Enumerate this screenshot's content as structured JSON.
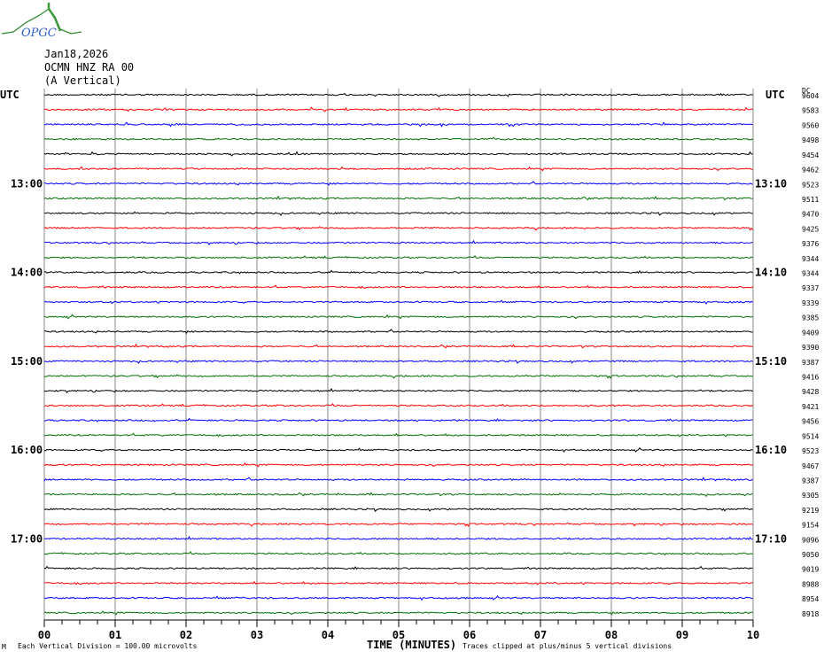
{
  "logo": {
    "text": "OPGC",
    "colors": {
      "curve": "#2e8b2e",
      "text": "#3060d0"
    }
  },
  "header": {
    "date": "Jan18,2026",
    "station": "OCMN HNZ RA 00",
    "component": "(A Vertical)"
  },
  "chart_data": {
    "type": "line",
    "title": "OCMN HNZ RA 00 (A Vertical) Jan18,2026",
    "xlabel": "TIME (MINUTES)",
    "xlim": [
      0,
      10
    ],
    "x_ticks": [
      "00",
      "01",
      "02",
      "03",
      "04",
      "05",
      "06",
      "07",
      "08",
      "09",
      "10"
    ],
    "left_axis_label": "UTC",
    "right_axis_label": "UTC",
    "dc_label": "DC",
    "rows_per_hour": 6,
    "left_time_labels": [
      {
        "row": 6,
        "text": "13:00"
      },
      {
        "row": 12,
        "text": "14:00"
      },
      {
        "row": 18,
        "text": "15:00"
      },
      {
        "row": 24,
        "text": "16:00"
      },
      {
        "row": 30,
        "text": "17:00"
      }
    ],
    "right_time_labels": [
      {
        "row": 6,
        "text": "13:10"
      },
      {
        "row": 12,
        "text": "14:10"
      },
      {
        "row": 18,
        "text": "15:10"
      },
      {
        "row": 24,
        "text": "16:10"
      },
      {
        "row": 30,
        "text": "17:10"
      }
    ],
    "dc_offsets": [
      "9604",
      "9583",
      "9560",
      "9498",
      "9454",
      "9462",
      "9523",
      "9511",
      "9470",
      "9425",
      "9376",
      "9344",
      "9344",
      "9337",
      "9339",
      "9385",
      "9409",
      "9390",
      "9387",
      "9416",
      "9428",
      "9421",
      "9456",
      "9514",
      "9523",
      "9467",
      "9387",
      "9305",
      "9219",
      "9154",
      "9096",
      "9050",
      "9019",
      "8988",
      "8954",
      "8918"
    ],
    "trace_colors": [
      "#000000",
      "#ff0000",
      "#0000ff",
      "#007000"
    ],
    "grid": true
  },
  "footer": {
    "scale_note": "Each Vertical Division =  100.00 microvolts",
    "clip_note": "Traces clipped at plus/minus 5 vertical divisions",
    "small_mark": "M"
  }
}
